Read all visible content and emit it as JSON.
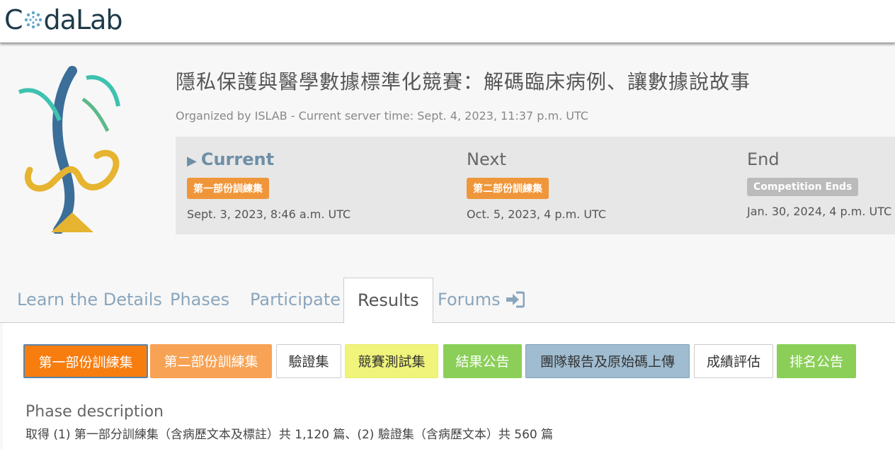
{
  "nav": {
    "logo_prefix": "C",
    "logo_suffix": "daLab"
  },
  "competition": {
    "title": "隱私保護與醫學數據標準化競賽：解碼臨床病例、讓數據說故事",
    "organized": "Organized by ISLAB - Current server time: Sept. 4, 2023, 11:37 p.m. UTC"
  },
  "phases": {
    "current": {
      "heading": "Current",
      "badge": "第一部份訓練集",
      "date": "Sept. 3, 2023, 8:46 a.m. UTC"
    },
    "next": {
      "heading": "Next",
      "badge": "第二部份訓練集",
      "date": "Oct. 5, 2023, 4 p.m. UTC"
    },
    "end": {
      "heading": "End",
      "badge": "Competition Ends",
      "date": "Jan. 30, 2024, 4 p.m. UTC"
    }
  },
  "tabs": {
    "learn": "Learn the Details",
    "phases": "Phases",
    "participate": "Participate",
    "results": "Results",
    "forums": "Forums",
    "active": "Results"
  },
  "phase_buttons": [
    "第一部份訓練集",
    "第二部份訓練集",
    "驗證集",
    "競賽測試集",
    "結果公告",
    "團隊報告及原始碼上傳",
    "成績評估",
    "排名公告"
  ],
  "description": {
    "title": "Phase description",
    "text": "取得 (1) 第一部分訓練集（含病歷文本及標註）共 1,120 篇、(2) 驗證集（含病歷文本）共 560 篇"
  },
  "colors": {
    "accent_orange": "#f77d0f",
    "light_orange": "#f7a254",
    "yellow": "#f0f47a",
    "green": "#8bcf58",
    "blue": "#9fbcd0",
    "tab_link": "#8aa6bd",
    "current_phase": "#6d8fa6"
  },
  "icons": {
    "forums": "sign-in-icon",
    "current_marker": "play-icon"
  }
}
